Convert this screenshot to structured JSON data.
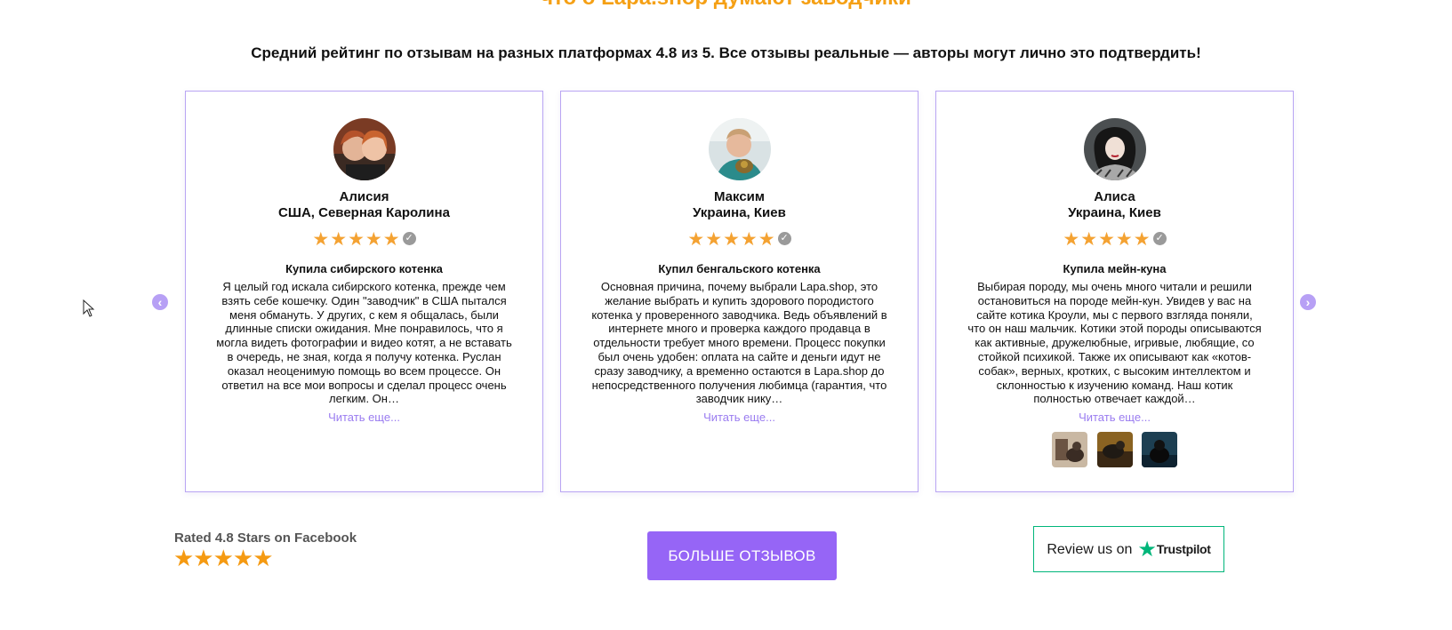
{
  "header": {
    "title": "что о Lapa.shop думают заводчики",
    "subtitle": "Средний рейтинг по отзывам на разных платформах 4.8 из 5. Все отзывы реальные — авторы могут лично это подтвердить!"
  },
  "reviews": [
    {
      "name": "Алисия",
      "location": "США, Северная Каролина",
      "stars": "★★★★★",
      "rating": 5,
      "verified_icon": "verified-check-icon",
      "title": "Купила сибирского котенка",
      "text": "Я целый год искала сибирского котенка, прежде чем взять себе кошечку. Один \"заводчик\" в США пытался меня обмануть. У других, с кем я общалась, были длинные списки ожидания. Мне понравилось, что я могла видеть фотографии и видео котят, а не вставать в очередь, не зная, когда я получу котенка. Руслан оказал неоценимую помощь во всем процессе. Он ответил на все мои вопросы и сделал процесс очень легким. Он…",
      "read_more": "Читать еще..."
    },
    {
      "name": "Максим",
      "location": "Украина, Киев",
      "stars": "★★★★★",
      "rating": 5,
      "verified_icon": "verified-check-icon",
      "title": "Купил бенгальского котенка",
      "text": "Основная причина, почему выбрали Lapa.shop, это желание выбрать и купить здорового породистого котенка у проверенного заводчика. Ведь объявлений в интернете много и проверка каждого продавца в отдельности требует много времени. Процесс покупки был очень удобен: оплата на сайте и деньги идут не сразу заводчику, а временно остаются в Lapa.shop до непосредственного получения любимца (гарантия, что заводчик нику…",
      "read_more": "Читать еще..."
    },
    {
      "name": "Алиса",
      "location": "Украина, Киев",
      "stars": "★★★★★",
      "rating": 5,
      "verified_icon": "verified-check-icon",
      "title": "Купила мейн-куна",
      "text": "Выбирая породу, мы очень много читали и решили остановиться на породе мейн-кун. Увидев у вас на сайте котика Кроули, мы с первого взгляда поняли, что он наш мальчик. Котики этой породы описываются как активные, дружелюбные, игривые, любящие, со стойкой психикой. Также их описывают как «котов-собак», верных, кротких, с высоким интеллектом и склонностью к изучению команд. Наш котик полностью отвечает каждой…",
      "read_more": "Читать еще..."
    }
  ],
  "carousel": {
    "prev_icon": "chevron-left-icon",
    "next_icon": "chevron-right-icon",
    "prev_glyph": "‹",
    "next_glyph": "›"
  },
  "footer": {
    "facebook_label": "Rated 4.8 Stars on Facebook",
    "facebook_stars": "★★★★★",
    "more_button": "БОЛЬШЕ ОТЗЫВОВ",
    "trustpilot_prefix": "Review us on",
    "trustpilot_star": "★",
    "trustpilot_brand": "Trustpilot"
  },
  "colors": {
    "accent_purple": "#9665f6",
    "star_orange": "#f4a232",
    "title_orange": "#f5a015",
    "trustpilot_green": "#00b67a"
  }
}
